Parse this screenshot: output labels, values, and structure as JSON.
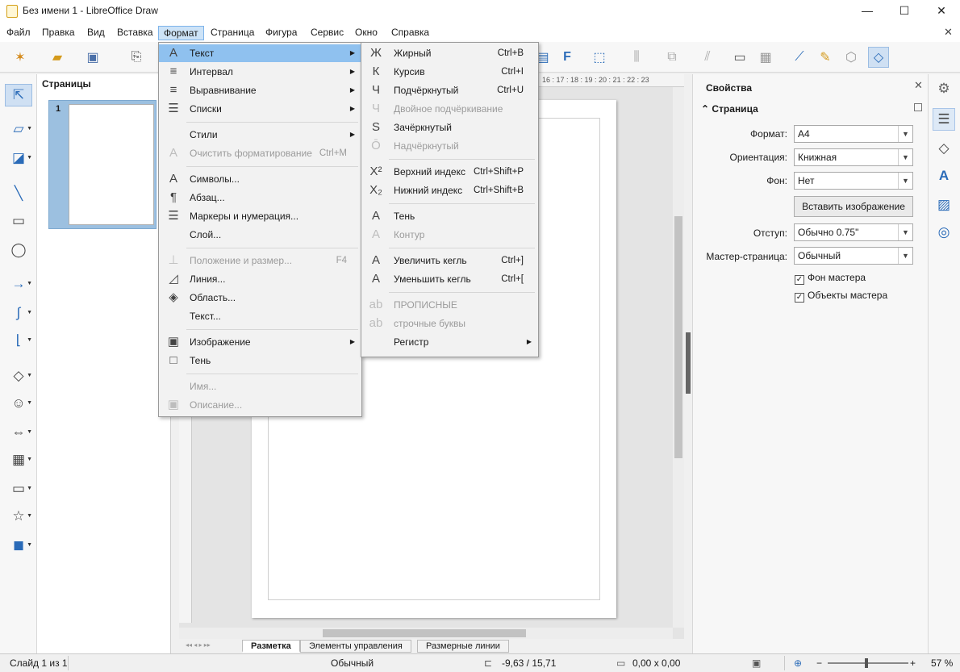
{
  "window": {
    "title": "Без имени 1 - LibreOffice Draw",
    "minimize": "—",
    "maximize": "☐",
    "close": "✕",
    "doc_close": "✕"
  },
  "menubar": [
    "Файл",
    "Правка",
    "Вид",
    "Вставка",
    "Формат",
    "Страница",
    "Фигура",
    "Сервис",
    "Окно",
    "Справка"
  ],
  "pages_pane": {
    "title": "Страницы",
    "page_number": "1"
  },
  "ruler_marks": "16 : 17 : 18 : 19 : 20 : 21 : 22 : 23",
  "format_menu": [
    {
      "label": "Текст",
      "icon": "A",
      "submenu": true,
      "highlighted": true
    },
    {
      "label": "Интервал",
      "icon": "≡",
      "submenu": true
    },
    {
      "label": "Выравнивание",
      "icon": "≡",
      "submenu": true
    },
    {
      "label": "Списки",
      "icon": "☰",
      "submenu": true
    },
    {
      "sep": true
    },
    {
      "label": "Стили",
      "icon": "",
      "submenu": true
    },
    {
      "label": "Очистить форматирование",
      "icon": "A",
      "shortcut": "Ctrl+M",
      "disabled": true
    },
    {
      "sep": true
    },
    {
      "label": "Символы...",
      "icon": "A"
    },
    {
      "label": "Абзац...",
      "icon": "¶"
    },
    {
      "label": "Маркеры и нумерация...",
      "icon": "☰"
    },
    {
      "label": "Слой...",
      "icon": ""
    },
    {
      "sep": true
    },
    {
      "label": "Положение и размер...",
      "icon": "⊥",
      "shortcut": "F4",
      "disabled": true
    },
    {
      "label": "Линия...",
      "icon": "◿"
    },
    {
      "label": "Область...",
      "icon": "◈"
    },
    {
      "label": "Текст...",
      "icon": ""
    },
    {
      "sep": true
    },
    {
      "label": "Изображение",
      "icon": "▣",
      "submenu": true
    },
    {
      "label": "Тень",
      "icon": "□"
    },
    {
      "sep": true
    },
    {
      "label": "Имя...",
      "icon": "",
      "disabled": true
    },
    {
      "label": "Описание...",
      "icon": "▣",
      "disabled": true
    }
  ],
  "text_menu": [
    {
      "label": "Жирный",
      "icon": "Ж",
      "shortcut": "Ctrl+B"
    },
    {
      "label": "Курсив",
      "icon": "К",
      "shortcut": "Ctrl+I"
    },
    {
      "label": "Подчёркнутый",
      "icon": "Ч",
      "shortcut": "Ctrl+U"
    },
    {
      "label": "Двойное подчёркивание",
      "icon": "Ч",
      "disabled": true
    },
    {
      "label": "Зачёркнутый",
      "icon": "S"
    },
    {
      "label": "Надчёркнутый",
      "icon": "Ō",
      "disabled": true
    },
    {
      "sep": true
    },
    {
      "label": "Верхний индекс",
      "icon": "X²",
      "shortcut": "Ctrl+Shift+P"
    },
    {
      "label": "Нижний индекс",
      "icon": "X₂",
      "shortcut": "Ctrl+Shift+B"
    },
    {
      "sep": true
    },
    {
      "label": "Тень",
      "icon": "A"
    },
    {
      "label": "Контур",
      "icon": "A",
      "disabled": true
    },
    {
      "sep": true
    },
    {
      "label": "Увеличить кегль",
      "icon": "A",
      "shortcut": "Ctrl+]"
    },
    {
      "label": "Уменьшить кегль",
      "icon": "A",
      "shortcut": "Ctrl+["
    },
    {
      "sep": true
    },
    {
      "label": "ПРОПИСНЫЕ",
      "icon": "ab",
      "disabled": true
    },
    {
      "label": "строчные буквы",
      "icon": "ab",
      "disabled": true
    },
    {
      "label": "Регистр",
      "icon": "",
      "submenu": true
    }
  ],
  "layer_tabs": [
    "Разметка",
    "Элементы управления",
    "Размерные линии"
  ],
  "sidebar": {
    "title": "Свойства",
    "section": "Страница",
    "format_label": "Формат:",
    "format_value": "A4",
    "orientation_label": "Ориентация:",
    "orientation_value": "Книжная",
    "background_label": "Фон:",
    "background_value": "Нет",
    "insert_image_button": "Вставить изображение",
    "margin_label": "Отступ:",
    "margin_value": "Обычно 0.75\"",
    "master_label": "Мастер-страница:",
    "master_value": "Обычный",
    "master_background": "Фон мастера",
    "master_objects": "Объекты мастера"
  },
  "status": {
    "slide": "Слайд 1 из 1",
    "layout": "Обычный",
    "position": "-9,63 / 15,71",
    "size": "0,00 x 0,00",
    "zoom": "57 %"
  }
}
